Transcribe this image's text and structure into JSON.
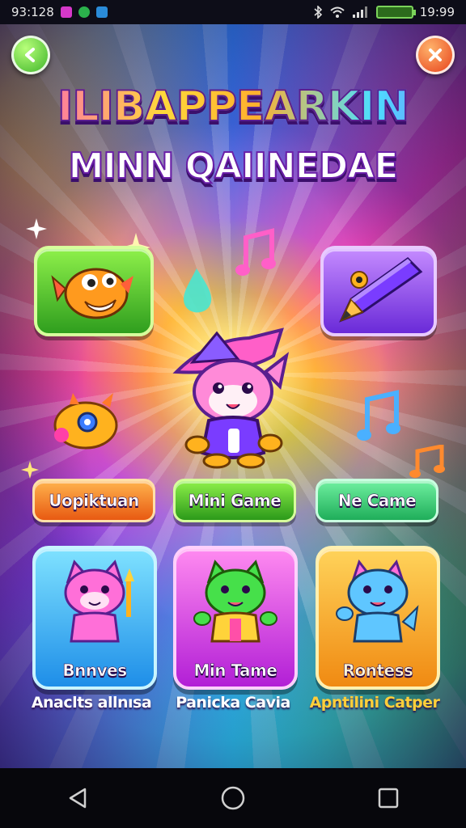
{
  "status_bar": {
    "time_left": "93:128",
    "time_right": "19:99",
    "app_icons": [
      "app-icon-pink",
      "app-icon-green",
      "app-icon-blue"
    ]
  },
  "header": {
    "title": "ILIBAPPEARKIN",
    "subtitle": "MINN QAIINEDAE"
  },
  "mode_buttons": [
    {
      "label": "Uopiktuan"
    },
    {
      "label": "Mini Game"
    },
    {
      "label": "Ne Came"
    }
  ],
  "cards": [
    {
      "label": "Bnnves",
      "caption": "Anaclts allnısa",
      "color": "#1e8ee8"
    },
    {
      "label": "Min Tame",
      "caption": "Panicka Cavia",
      "color": "#b21fd6"
    },
    {
      "label": "Rontess",
      "caption": "Apntilini Catper",
      "color": "#f08a12"
    }
  ],
  "icons": {
    "back": "back-arrow-icon",
    "close": "close-x-icon",
    "nav_back": "triangle-back-icon",
    "nav_home": "circle-home-icon",
    "nav_recents": "square-recents-icon"
  },
  "colors": {
    "title_gradient": [
      "#ff4fd0",
      "#ffd83a",
      "#4ce0ff"
    ],
    "title_outline": "#5a1f8f",
    "caption_highlight": "#ffcf3a"
  }
}
